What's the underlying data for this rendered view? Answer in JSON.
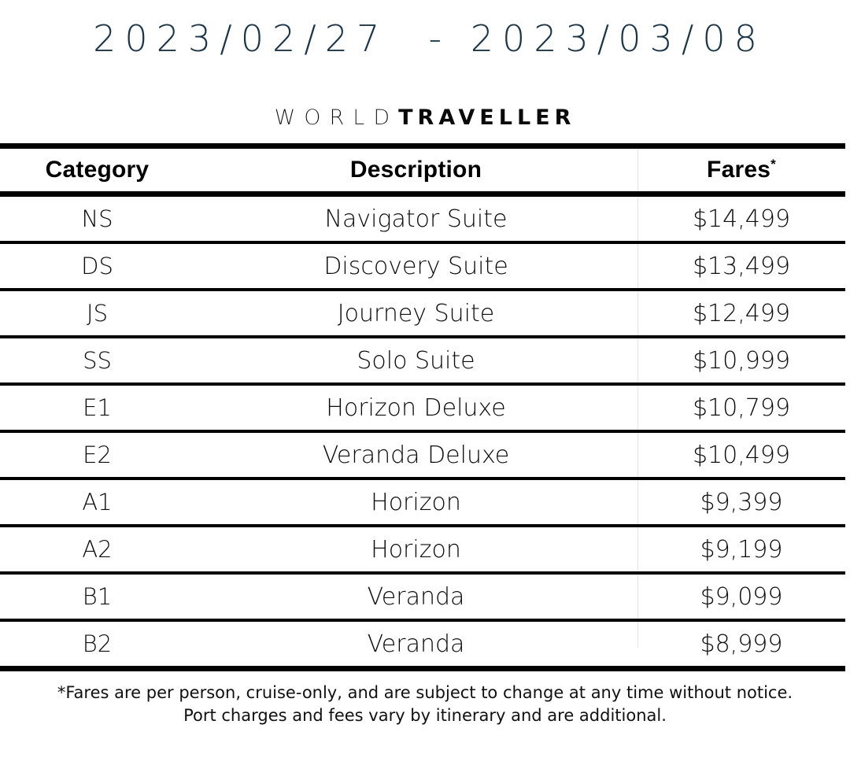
{
  "header": {
    "date_range": "2023/02/27  - 2023/03/08",
    "date_range_color": "#1c3547"
  },
  "brand": {
    "word_light": "WORLD",
    "word_bold": "TRAVELLER",
    "color": "#0a0a0a"
  },
  "table": {
    "columns": [
      {
        "key": "category",
        "label": "Category"
      },
      {
        "key": "description",
        "label": "Description"
      },
      {
        "key": "fares",
        "label": "Fares",
        "superscript": "*"
      }
    ],
    "rows": [
      {
        "category": "NS",
        "description": "Navigator Suite",
        "fare": "$14,499"
      },
      {
        "category": "DS",
        "description": "Discovery Suite",
        "fare": "$13,499"
      },
      {
        "category": "JS",
        "description": "Journey Suite",
        "fare": "$12,499"
      },
      {
        "category": "SS",
        "description": "Solo Suite",
        "fare": "$10,999"
      },
      {
        "category": "E1",
        "description": "Horizon Deluxe",
        "fare": "$10,799"
      },
      {
        "category": "E2",
        "description": "Veranda Deluxe",
        "fare": "$10,499"
      },
      {
        "category": "A1",
        "description": "Horizon",
        "fare": "$9,399"
      },
      {
        "category": "A2",
        "description": "Horizon",
        "fare": "$9,199"
      },
      {
        "category": "B1",
        "description": "Veranda",
        "fare": "$9,099"
      },
      {
        "category": "B2",
        "description": "Veranda",
        "fare": "$8,999"
      }
    ]
  },
  "footnote": {
    "line1": "*Fares are per person, cruise-only, and are subject to change at any time without notice.",
    "line2": "Port charges and fees vary by itinerary and are additional."
  }
}
